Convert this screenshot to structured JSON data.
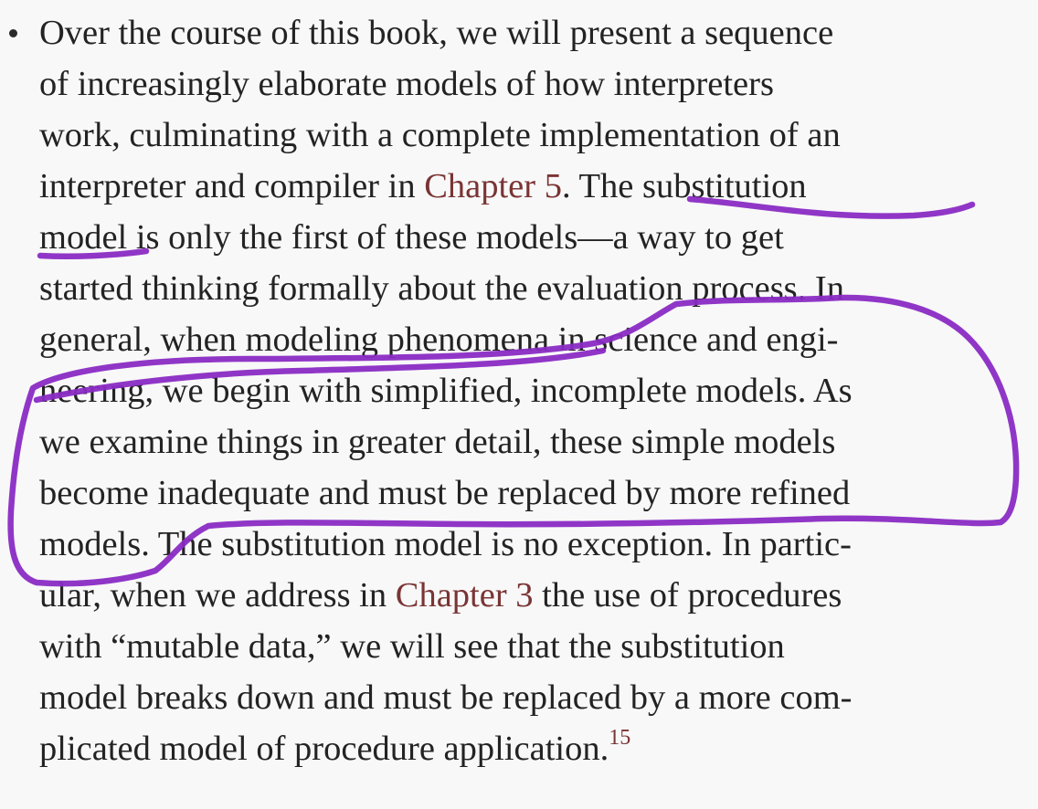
{
  "paragraph": {
    "line1": "Over the course of this book, we will present a sequence",
    "line2": "of increasingly elaborate models of how interpreters",
    "line3": "work, culminating with a complete implementation of an",
    "line4_pre": "interpreter and compiler in ",
    "chapter5_link": "Chapter 5",
    "line4_post": ". The substitution",
    "line5": "model is only the first of these models—a way to get",
    "line6": "started thinking formally about the evaluation process. In",
    "line7": "general, when modeling phenomena in science and engi-",
    "line8": "neering, we begin with simplified, incomplete models. As",
    "line9": "we examine things in greater detail, these simple models",
    "line10": "become inadequate and must be replaced by more refined",
    "line11": "models. The substitution model is no exception. In partic-",
    "line12_pre": "ular, when we address in ",
    "chapter3_link": "Chapter 3",
    "line12_post": " the use of procedures",
    "line13": "with “mutable data,” we will see that the substitution",
    "line14": "model breaks down and must be replaced by a more com-",
    "line15": "plicated model of procedure application.",
    "footnote": "15"
  },
  "colors": {
    "text": "#232323",
    "link": "#7a3434",
    "annotation": "#8a2bc4",
    "background": "#f8f8f8"
  },
  "icons": {
    "bullet": "bullet-dot"
  }
}
